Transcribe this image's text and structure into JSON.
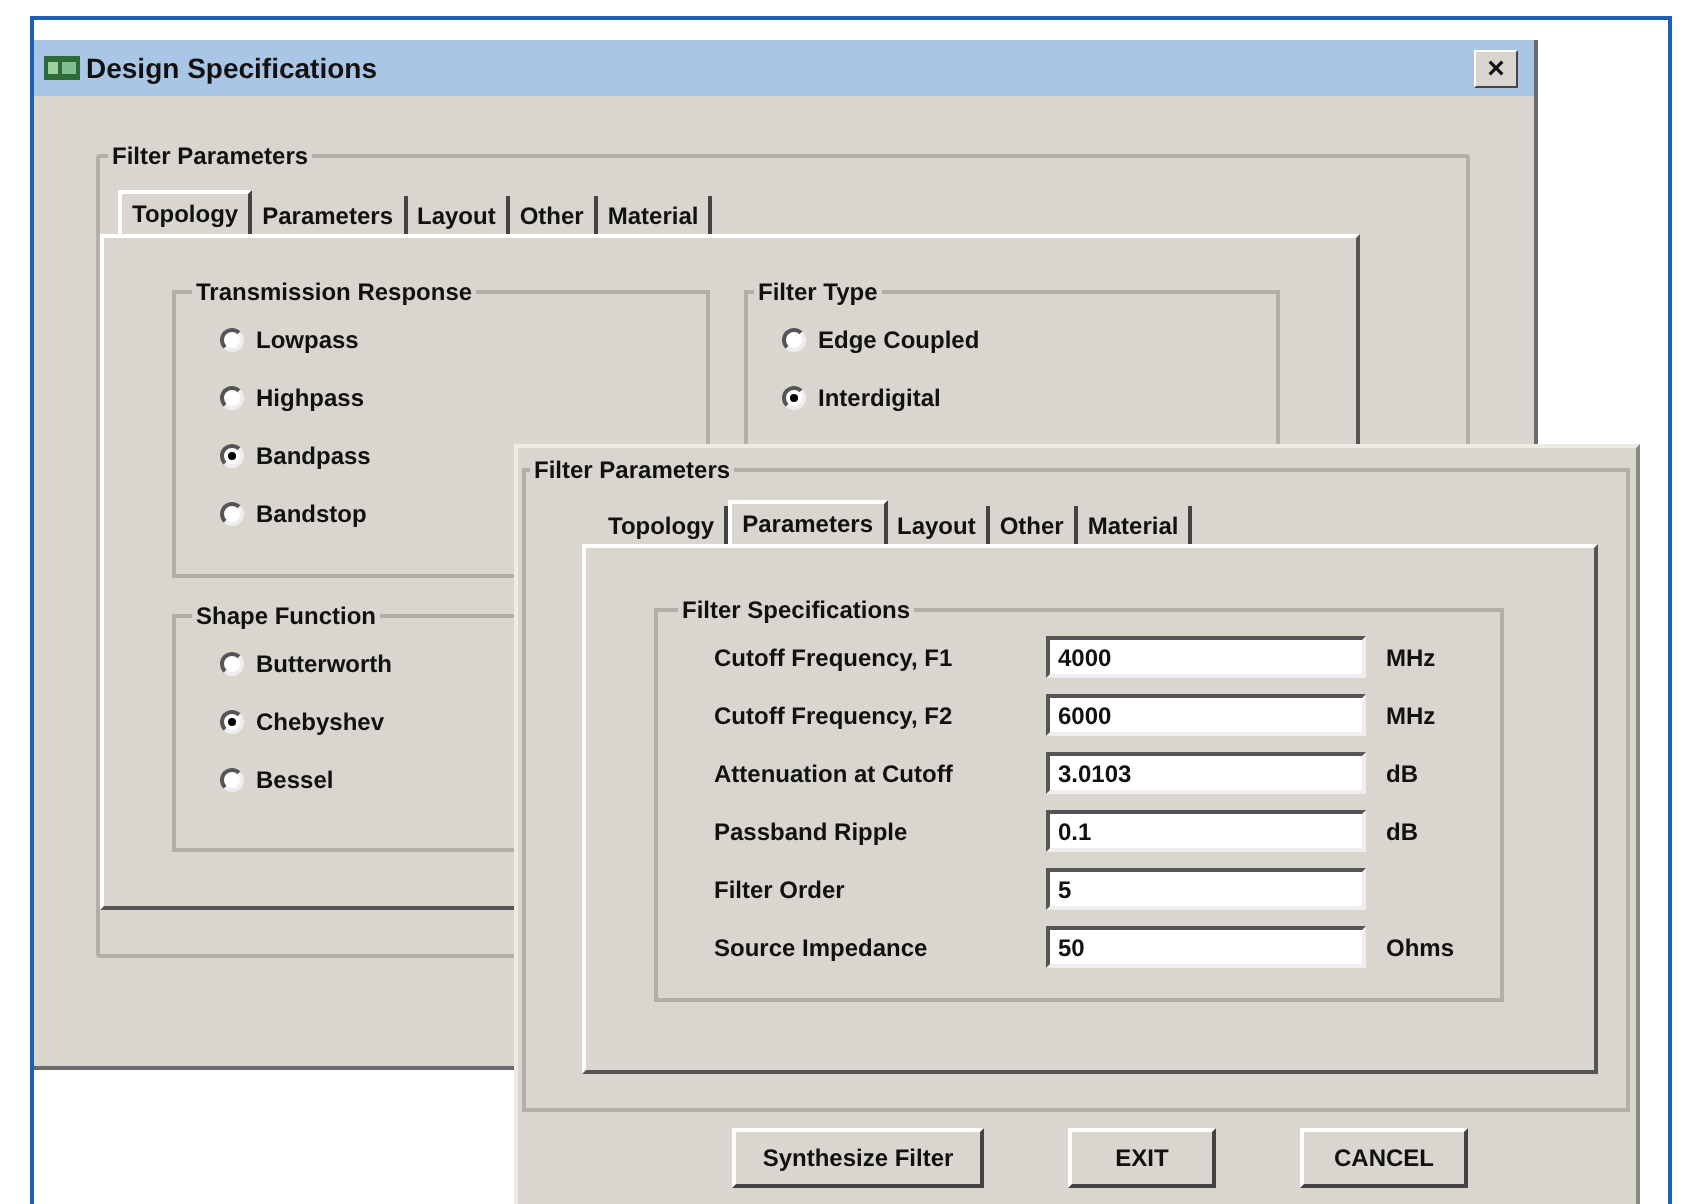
{
  "window": {
    "title": "Design Specifications",
    "close": "×"
  },
  "back_panel": {
    "group_title": "Filter Parameters",
    "tabs": [
      {
        "label": "Topology",
        "selected": true
      },
      {
        "label": "Parameters",
        "selected": false
      },
      {
        "label": "Layout",
        "selected": false
      },
      {
        "label": "Other",
        "selected": false
      },
      {
        "label": "Material",
        "selected": false
      }
    ],
    "transmission_response": {
      "title": "Transmission Response",
      "options": [
        {
          "label": "Lowpass",
          "selected": false
        },
        {
          "label": "Highpass",
          "selected": false
        },
        {
          "label": "Bandpass",
          "selected": true
        },
        {
          "label": "Bandstop",
          "selected": false
        }
      ]
    },
    "filter_type": {
      "title": "Filter Type",
      "options": [
        {
          "label": "Edge Coupled",
          "selected": false
        },
        {
          "label": "Interdigital",
          "selected": true
        }
      ]
    },
    "shape_function": {
      "title": "Shape Function",
      "options": [
        {
          "label": "Butterworth",
          "selected": false
        },
        {
          "label": "Chebyshev",
          "selected": true
        },
        {
          "label": "Bessel",
          "selected": false
        }
      ]
    }
  },
  "front_panel": {
    "group_title": "Filter Parameters",
    "tabs": [
      {
        "label": "Topology",
        "selected": false
      },
      {
        "label": "Parameters",
        "selected": true
      },
      {
        "label": "Layout",
        "selected": false
      },
      {
        "label": "Other",
        "selected": false
      },
      {
        "label": "Material",
        "selected": false
      }
    ],
    "specifications": {
      "title": "Filter Specifications",
      "rows": [
        {
          "label": "Cutoff Frequency, F1",
          "value": "4000",
          "unit": "MHz"
        },
        {
          "label": "Cutoff Frequency, F2",
          "value": "6000",
          "unit": "MHz"
        },
        {
          "label": "Attenuation at Cutoff",
          "value": "3.0103",
          "unit": "dB"
        },
        {
          "label": "Passband Ripple",
          "value": "0.1",
          "unit": "dB"
        },
        {
          "label": "Filter Order",
          "value": "5"
        },
        {
          "label": "Source Impedance",
          "value": "50",
          "unit": "Ohms"
        }
      ]
    },
    "buttons": [
      "Synthesize Filter",
      "EXIT",
      "CANCEL"
    ]
  }
}
